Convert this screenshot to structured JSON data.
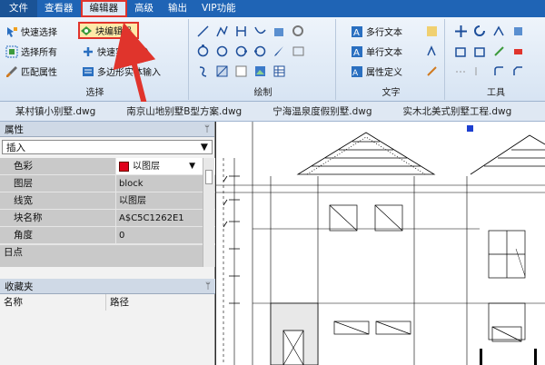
{
  "menubar": {
    "items": [
      "文件",
      "查看器",
      "编辑器",
      "高级",
      "输出",
      "VIP功能"
    ],
    "active": "编辑器"
  },
  "ribbon": {
    "select_group": {
      "title": "选择",
      "quick_select": "快速选择",
      "select_all": "选择所有",
      "match_props": "匹配属性",
      "block_editor": "块编辑器",
      "quick_entity_import": "快速实体导入",
      "polygon_entity_input": "多边形实体输入"
    },
    "draw_group": {
      "title": "绘制"
    },
    "text_group": {
      "title": "文字",
      "mtext": "多行文本",
      "stext": "单行文本",
      "attdef": "属性定义"
    },
    "tools_group": {
      "title": "工具"
    }
  },
  "doc_tabs": [
    "某村镇小别墅.dwg",
    "南京山地别墅B型方案.dwg",
    "宁海温泉度假别墅.dwg",
    "实木北美式别墅工程.dwg"
  ],
  "properties_panel": {
    "title": "属性",
    "pin": "ᛘ",
    "combo_value": "插入",
    "rows": [
      {
        "key": "色彩",
        "value": "以图层"
      },
      {
        "key": "图层",
        "value": "block"
      },
      {
        "key": "线宽",
        "value": "以图层"
      },
      {
        "key": "块名称",
        "value": "A$C5C1262E1"
      },
      {
        "key": "角度",
        "value": "0"
      }
    ],
    "section": "日点"
  },
  "favorites_panel": {
    "title": "收藏夹",
    "pin": "ᛘ",
    "col_name": "名称",
    "col_path": "路径"
  },
  "colors": {
    "menubar": "#1f64b5",
    "highlight_red": "#e0342c",
    "layer_color": "#e0001a"
  }
}
